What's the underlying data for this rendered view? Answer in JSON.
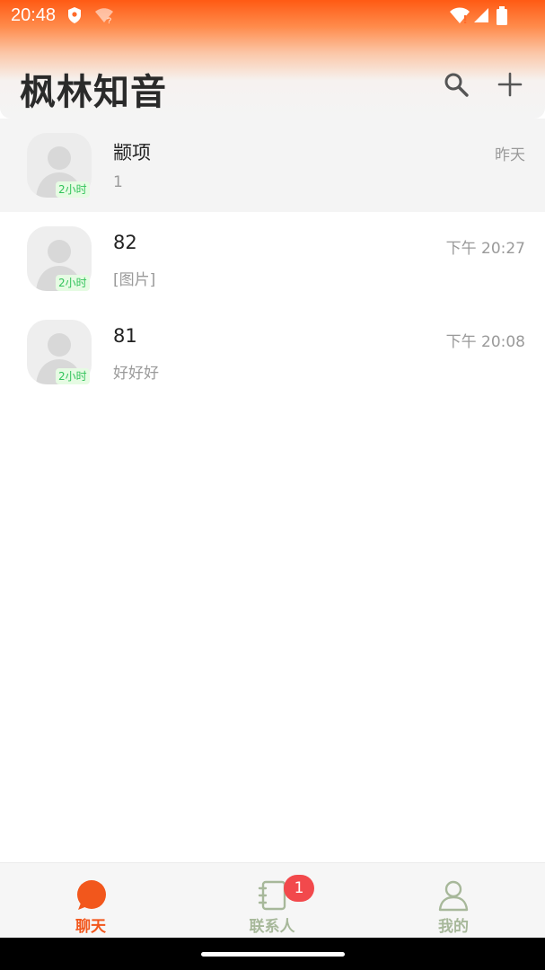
{
  "status_bar": {
    "time": "20:48"
  },
  "header": {
    "title": "枫林知音",
    "search_icon": "search-icon",
    "add_icon": "plus-icon"
  },
  "conversations": [
    {
      "name": "颛项",
      "message": "1",
      "time": "昨天",
      "badge": "2小时"
    },
    {
      "name": "82",
      "message": "[图片]",
      "time": "下午 20:27",
      "badge": "2小时"
    },
    {
      "name": "81",
      "message": "好好好",
      "time": "下午 20:08",
      "badge": "2小时"
    }
  ],
  "tabbar": {
    "tabs": [
      {
        "label": "聊天",
        "icon": "chat-bubble-icon"
      },
      {
        "label": "联系人",
        "icon": "contacts-book-icon"
      },
      {
        "label": "我的",
        "icon": "person-icon"
      }
    ],
    "contacts_badge": "1"
  },
  "colors": {
    "accent": "#f2571c",
    "inactive_tab": "#a7b89a",
    "badge_red": "#f2494c",
    "online_green": "#31c35a"
  }
}
